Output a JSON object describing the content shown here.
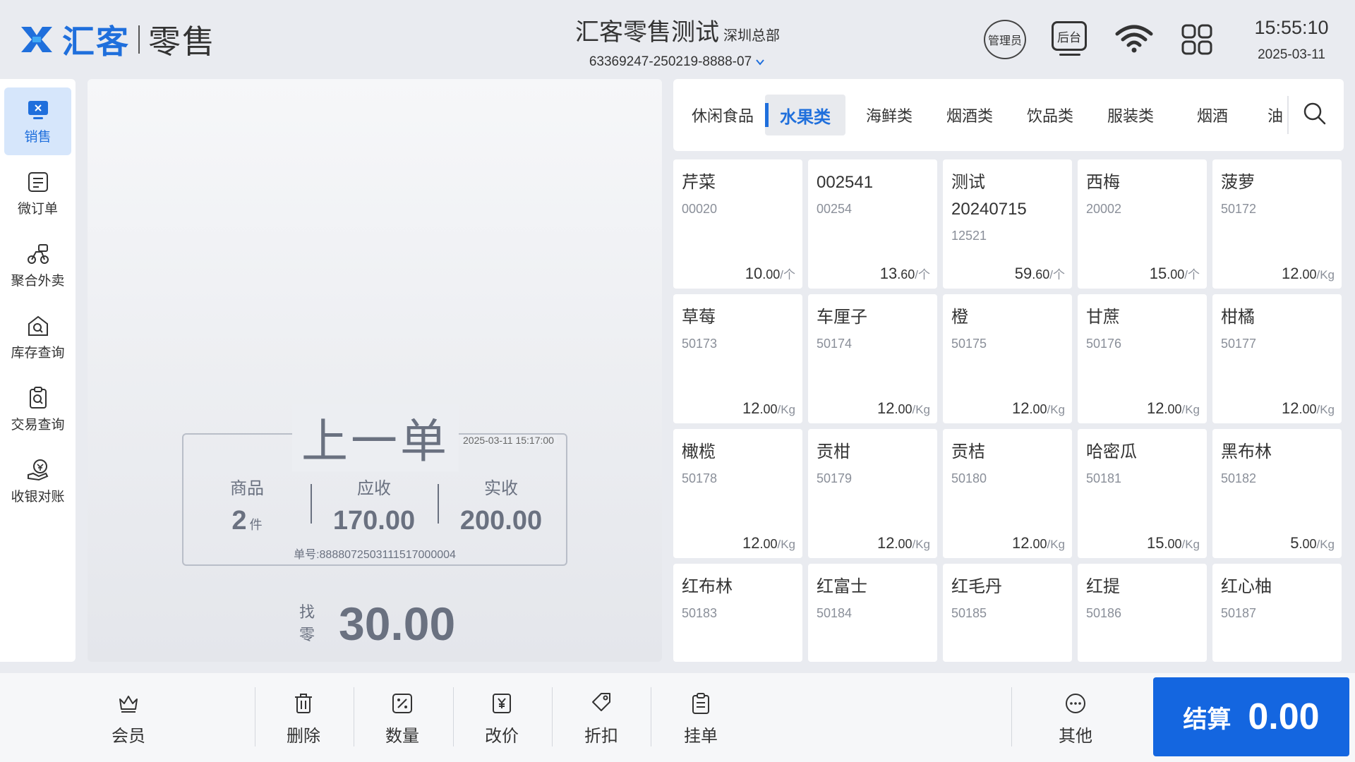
{
  "header": {
    "brand": "汇客",
    "product": "零售",
    "store_name": "汇客零售测试",
    "store_branch": "深圳总部",
    "order_session": "63369247-250219-8888-07",
    "admin_badge": "管理员",
    "backend_label": "后台",
    "time": "15:55:10",
    "date": "2025-03-11",
    "accent": "#1f6fdc"
  },
  "sidebar": {
    "items": [
      {
        "label": "销售",
        "icon": "sales-icon",
        "active": true
      },
      {
        "label": "微订单",
        "icon": "micro-order-icon"
      },
      {
        "label": "聚合外卖",
        "icon": "delivery-icon"
      },
      {
        "label": "库存查询",
        "icon": "inventory-search-icon"
      },
      {
        "label": "交易查询",
        "icon": "transaction-search-icon"
      },
      {
        "label": "收银对账",
        "icon": "reconciliation-icon"
      }
    ]
  },
  "last_order": {
    "title": "上一单",
    "time": "2025-03-11 15:17:00",
    "goods_label": "商品",
    "goods_count": "2",
    "goods_unit": "件",
    "due_label": "应收",
    "due": "170.00",
    "paid_label": "实收",
    "paid": "200.00",
    "order_no": "单号:8888072503111517000004",
    "change_label_1": "找",
    "change_label_2": "零",
    "change": "30.00"
  },
  "tabs": [
    {
      "label": "休闲食品"
    },
    {
      "label": "水果类",
      "active": true
    },
    {
      "label": "海鲜类"
    },
    {
      "label": "烟酒类"
    },
    {
      "label": "饮品类"
    },
    {
      "label": "服装类"
    },
    {
      "label": "烟酒"
    },
    {
      "label": "油"
    }
  ],
  "products": [
    {
      "name": "芹菜",
      "code": "00020",
      "price_int": "10",
      "price_dec": ".00",
      "unit": "/个"
    },
    {
      "name": "002541",
      "code": "00254",
      "price_int": "13",
      "price_dec": ".60",
      "unit": "/个"
    },
    {
      "name": "测试20240715",
      "code": "12521",
      "price_int": "59",
      "price_dec": ".60",
      "unit": "/个"
    },
    {
      "name": "西梅",
      "code": "20002",
      "price_int": "15",
      "price_dec": ".00",
      "unit": "/个"
    },
    {
      "name": "菠萝",
      "code": "50172",
      "price_int": "12",
      "price_dec": ".00",
      "unit": "/Kg"
    },
    {
      "name": "草莓",
      "code": "50173",
      "price_int": "12",
      "price_dec": ".00",
      "unit": "/Kg"
    },
    {
      "name": "车厘子",
      "code": "50174",
      "price_int": "12",
      "price_dec": ".00",
      "unit": "/Kg"
    },
    {
      "name": "橙",
      "code": "50175",
      "price_int": "12",
      "price_dec": ".00",
      "unit": "/Kg"
    },
    {
      "name": "甘蔗",
      "code": "50176",
      "price_int": "12",
      "price_dec": ".00",
      "unit": "/Kg"
    },
    {
      "name": "柑橘",
      "code": "50177",
      "price_int": "12",
      "price_dec": ".00",
      "unit": "/Kg"
    },
    {
      "name": "橄榄",
      "code": "50178",
      "price_int": "12",
      "price_dec": ".00",
      "unit": "/Kg"
    },
    {
      "name": "贡柑",
      "code": "50179",
      "price_int": "12",
      "price_dec": ".00",
      "unit": "/Kg"
    },
    {
      "name": "贡桔",
      "code": "50180",
      "price_int": "12",
      "price_dec": ".00",
      "unit": "/Kg"
    },
    {
      "name": "哈密瓜",
      "code": "50181",
      "price_int": "15",
      "price_dec": ".00",
      "unit": "/Kg"
    },
    {
      "name": "黑布林",
      "code": "50182",
      "price_int": "5",
      "price_dec": ".00",
      "unit": "/Kg"
    },
    {
      "name": "红布林",
      "code": "50183"
    },
    {
      "name": "红富士",
      "code": "50184"
    },
    {
      "name": "红毛丹",
      "code": "50185"
    },
    {
      "name": "红提",
      "code": "50186"
    },
    {
      "name": "红心柚",
      "code": "50187"
    }
  ],
  "actions": {
    "member": "会员",
    "delete": "删除",
    "quantity": "数量",
    "change_price": "改价",
    "discount": "折扣",
    "hold": "挂单",
    "other": "其他"
  },
  "checkout": {
    "label": "结算",
    "amount": "0.00",
    "color": "#1466e0"
  }
}
